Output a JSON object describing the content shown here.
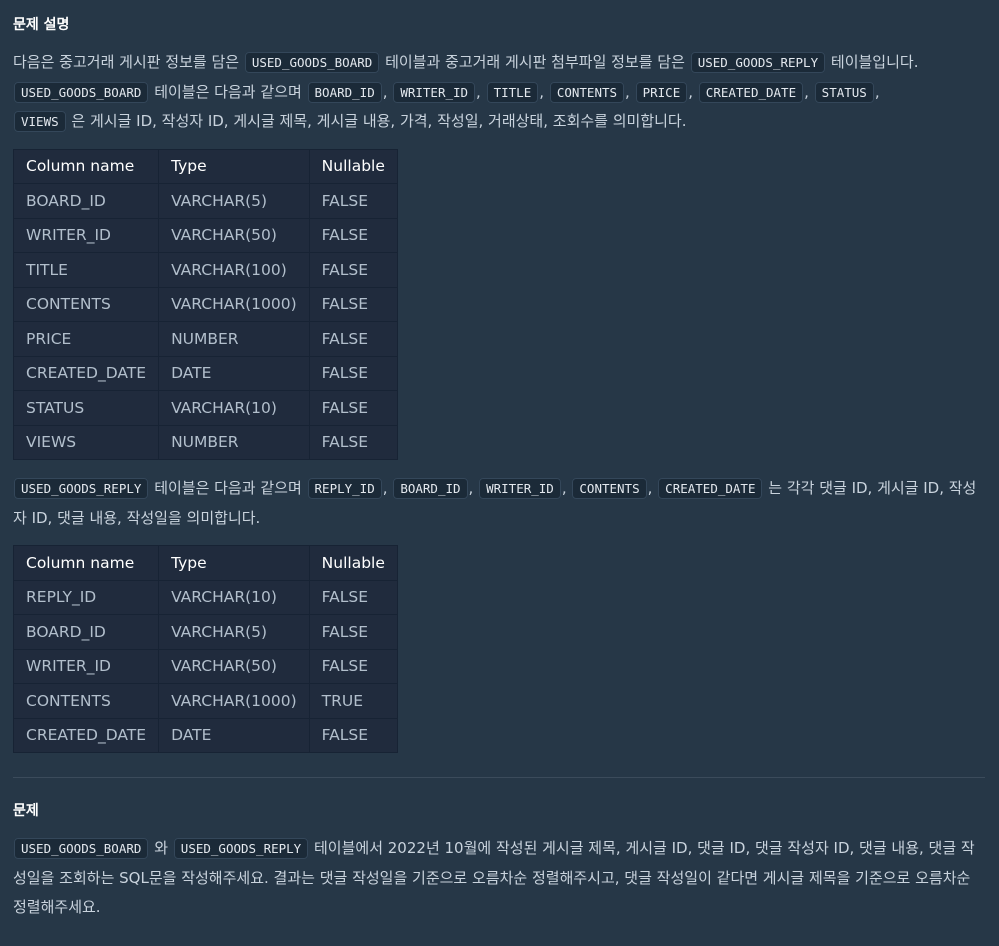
{
  "section_title": "문제 설명",
  "intro": {
    "t1": "다음은 중고거래 게시판 정보를 담은",
    "c1": "USED_GOODS_BOARD",
    "t2": "테이블과 중고거래 게시판 첨부파일 정보를 담은",
    "c2": "USED_GOODS_REPLY",
    "t3": "테이블입니다."
  },
  "board_desc": {
    "c_table": "USED_GOODS_BOARD",
    "t_intro": "테이블은 다음과 같으며",
    "cols": [
      "BOARD_ID",
      "WRITER_ID",
      "TITLE",
      "CONTENTS",
      "PRICE",
      "CREATED_DATE",
      "STATUS",
      "VIEWS"
    ],
    "sep": ",",
    "t_end": "은 게시글 ID, 작성자 ID, 게시글 제목, 게시글 내용, 가격, 작성일, 거래상태, 조회수를 의미합니다."
  },
  "table_headers": [
    "Column name",
    "Type",
    "Nullable"
  ],
  "board_table": [
    [
      "BOARD_ID",
      "VARCHAR(5)",
      "FALSE"
    ],
    [
      "WRITER_ID",
      "VARCHAR(50)",
      "FALSE"
    ],
    [
      "TITLE",
      "VARCHAR(100)",
      "FALSE"
    ],
    [
      "CONTENTS",
      "VARCHAR(1000)",
      "FALSE"
    ],
    [
      "PRICE",
      "NUMBER",
      "FALSE"
    ],
    [
      "CREATED_DATE",
      "DATE",
      "FALSE"
    ],
    [
      "STATUS",
      "VARCHAR(10)",
      "FALSE"
    ],
    [
      "VIEWS",
      "NUMBER",
      "FALSE"
    ]
  ],
  "reply_desc": {
    "c_table": "USED_GOODS_REPLY",
    "t_intro": "테이블은 다음과 같으며",
    "cols": [
      "REPLY_ID",
      "BOARD_ID",
      "WRITER_ID",
      "CONTENTS",
      "CREATED_DATE"
    ],
    "t_end": "는 각각 댓글 ID, 게시글 ID, 작성자 ID, 댓글 내용, 작성일을 의미합니다."
  },
  "reply_table": [
    [
      "REPLY_ID",
      "VARCHAR(10)",
      "FALSE"
    ],
    [
      "BOARD_ID",
      "VARCHAR(5)",
      "FALSE"
    ],
    [
      "WRITER_ID",
      "VARCHAR(50)",
      "FALSE"
    ],
    [
      "CONTENTS",
      "VARCHAR(1000)",
      "TRUE"
    ],
    [
      "CREATED_DATE",
      "DATE",
      "FALSE"
    ]
  ],
  "problem_title": "문제",
  "problem": {
    "c1": "USED_GOODS_BOARD",
    "t1": "와",
    "c2": "USED_GOODS_REPLY",
    "t2": "테이블에서 2022년 10월에 작성된 게시글 제목, 게시글 ID, 댓글 ID, 댓글 작성자 ID, 댓글 내용, 댓글 작성일을 조회하는 SQL문을 작성해주세요. 결과는 댓글 작성일을 기준으로 오름차순 정렬해주시고, 댓글 작성일이 같다면 게시글 제목을 기준으로 오름차순 정렬해주세요."
  }
}
